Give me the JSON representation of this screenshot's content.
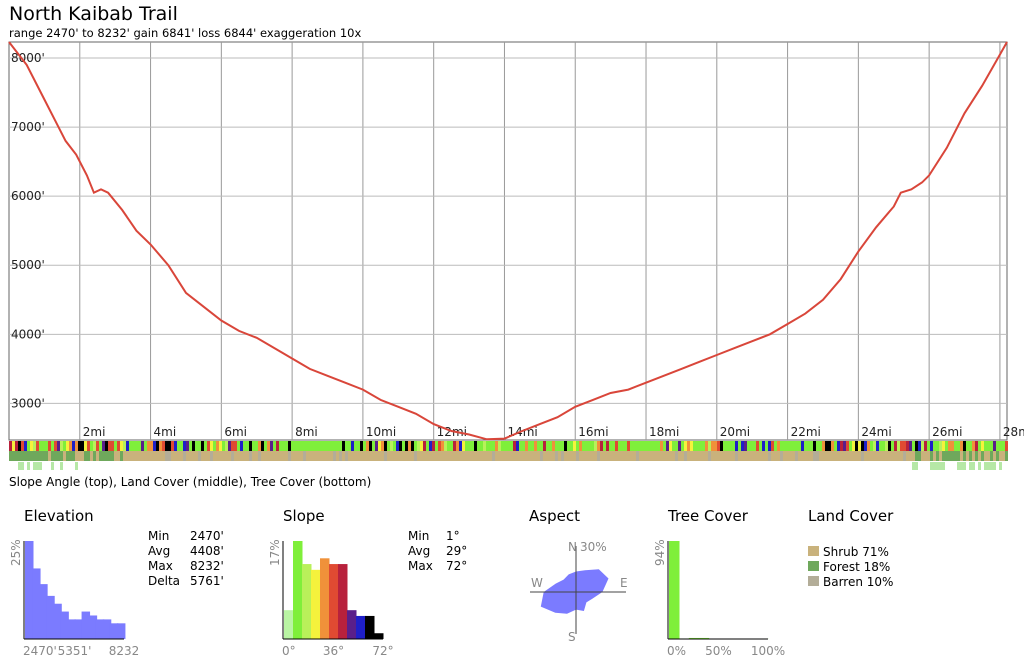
{
  "header": {
    "title": "North Kaibab Trail",
    "subtitle": "range 2470' to 8232'  gain 6841'  loss 6844'  exaggeration 10x"
  },
  "strip_caption": "Slope Angle (top), Land Cover (middle), Tree Cover (bottom)",
  "chart_data": [
    {
      "type": "line",
      "name": "elevation-profile",
      "x_ticks": [
        "2mi",
        "4mi",
        "6mi",
        "8mi",
        "10mi",
        "12mi",
        "14mi",
        "16mi",
        "18mi",
        "20mi",
        "22mi",
        "24mi",
        "26mi",
        "28mi"
      ],
      "y_ticks": [
        "3000'",
        "4000'",
        "5000'",
        "6000'",
        "7000'",
        "8000'"
      ],
      "ylim": [
        2470,
        8232
      ],
      "xlim": [
        0,
        28.2
      ],
      "grid": true,
      "line_color": "#d9463a",
      "x": [
        0,
        0.5,
        1,
        1.4,
        1.6,
        1.9,
        2.2,
        2.4,
        2.6,
        2.8,
        3.2,
        3.6,
        4,
        4.5,
        5,
        5.5,
        6,
        6.5,
        7,
        7.5,
        8,
        8.5,
        9,
        9.5,
        10,
        10.5,
        11,
        11.5,
        12,
        12.5,
        13,
        13.5,
        14,
        14.5,
        15,
        15.5,
        16,
        16.5,
        17,
        17.5,
        18,
        18.5,
        19,
        19.5,
        20,
        20.5,
        21,
        21.5,
        22,
        22.5,
        23,
        23.5,
        24,
        24.5,
        25,
        25.2,
        25.5,
        25.8,
        26,
        26.5,
        27,
        27.5,
        28,
        28.2
      ],
      "y": [
        8232,
        7900,
        7400,
        7000,
        6800,
        6600,
        6300,
        6050,
        6100,
        6050,
        5800,
        5500,
        5300,
        5000,
        4600,
        4400,
        4200,
        4050,
        3950,
        3800,
        3650,
        3500,
        3400,
        3300,
        3200,
        3050,
        2950,
        2850,
        2700,
        2600,
        2550,
        2480,
        2490,
        2600,
        2700,
        2800,
        2950,
        3050,
        3150,
        3200,
        3300,
        3400,
        3500,
        3600,
        3700,
        3800,
        3900,
        4000,
        4150,
        4300,
        4500,
        4800,
        5200,
        5550,
        5850,
        6050,
        6100,
        6200,
        6300,
        6700,
        7200,
        7600,
        8050,
        8232
      ]
    },
    {
      "type": "bar",
      "name": "elevation-histogram",
      "title": "Elevation",
      "x_tick_labels": [
        "2470'",
        "5351'",
        "8232"
      ],
      "y_label": "25%",
      "color": "#7b7bff",
      "values": [
        25,
        18,
        14,
        11,
        9,
        7,
        5,
        5,
        7,
        6,
        5,
        5,
        4,
        4
      ],
      "stats": [
        {
          "label": "Min",
          "value": "2470'"
        },
        {
          "label": "Avg",
          "value": "4408'"
        },
        {
          "label": "Max",
          "value": "8232'"
        },
        {
          "label": "Delta",
          "value": "5761'"
        }
      ]
    },
    {
      "type": "bar",
      "name": "slope-histogram",
      "title": "Slope",
      "x_tick_labels": [
        "0°",
        "36°",
        "72°"
      ],
      "y_label": "17%",
      "values": [
        5,
        17,
        13,
        12,
        14,
        13,
        13,
        5,
        4,
        4,
        1
      ],
      "colors": [
        "#b9f4a3",
        "#7fef3a",
        "#b9f05a",
        "#f5f23c",
        "#f0913a",
        "#e04a32",
        "#b8213c",
        "#5a1f8a",
        "#1f1fc8",
        "#000000",
        "#000000"
      ],
      "stats": [
        {
          "label": "Min",
          "value": "1°"
        },
        {
          "label": "Avg",
          "value": "29°"
        },
        {
          "label": "Max",
          "value": "72°"
        }
      ]
    },
    {
      "type": "pie",
      "name": "aspect-rose",
      "title": "Aspect",
      "labels": {
        "n": "N",
        "s": "S",
        "e": "E",
        "w": "W",
        "scale": "30%"
      },
      "color": "#7b7bff",
      "values": [
        14,
        16,
        22,
        24,
        18,
        12,
        10,
        14,
        12,
        16,
        20,
        26,
        22,
        15,
        12,
        13
      ]
    },
    {
      "type": "bar",
      "name": "tree-cover-histogram",
      "title": "Tree Cover",
      "x_tick_labels": [
        "0%",
        "50%",
        "100%"
      ],
      "y_label": "94%",
      "color": "#7fef3a",
      "values": [
        94,
        0.5,
        1,
        1,
        0.4,
        0.3,
        0.3,
        0.2,
        0.2,
        0.2
      ]
    },
    {
      "type": "pie",
      "name": "land-cover-legend",
      "title": "Land Cover",
      "entries": [
        {
          "label": "Shrub 71%",
          "color": "#c9b27c"
        },
        {
          "label": "Forest 18%",
          "color": "#6fa85c"
        },
        {
          "label": "Barren 10%",
          "color": "#b3ad98"
        }
      ]
    }
  ]
}
